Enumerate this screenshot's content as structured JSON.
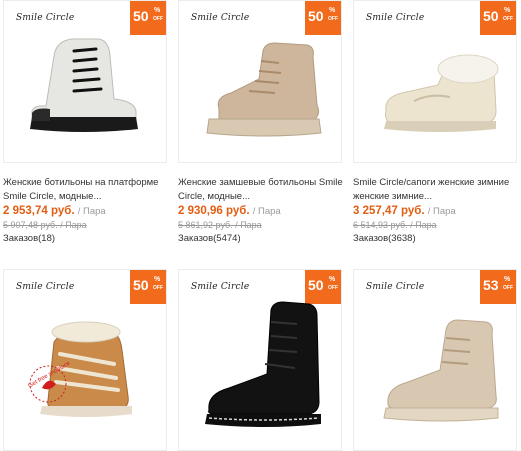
{
  "products": [
    {
      "brand": "Smile Circle",
      "discount": "50",
      "pct": "%",
      "off": "OFF",
      "title": "Женские ботильоны на платформе Smile Circle, модные...",
      "price": "2 953,74 руб.",
      "unit": "/ Пара",
      "old_price": "5 907,48 руб. / Пара",
      "orders": "Заказов(18)"
    },
    {
      "brand": "Smile Circle",
      "discount": "50",
      "pct": "%",
      "off": "OFF",
      "title": "Женские замшевые ботильоны Smile Circle, модные...",
      "price": "2 930,96 руб.",
      "unit": "/ Пара",
      "old_price": "5 861,92 руб. / Пара",
      "orders": "Заказов(5474)"
    },
    {
      "brand": "Smile Circle",
      "discount": "50",
      "pct": "%",
      "off": "OFF",
      "title": "Smile Circle/сапоги женские зимние женские зимние...",
      "price": "3 257,47 руб.",
      "unit": "/ Пара",
      "old_price": "6 514,93 руб. / Пара",
      "orders": "Заказов(3638)"
    },
    {
      "brand": "Smile Circle",
      "discount": "50",
      "pct": "%",
      "off": "OFF",
      "stamp": "Get free shoelace"
    },
    {
      "brand": "Smile Circle",
      "discount": "50",
      "pct": "%",
      "off": "OFF"
    },
    {
      "brand": "Smile Circle",
      "discount": "53",
      "pct": "%",
      "off": "OFF"
    }
  ],
  "colors": {
    "accent": "#f26a1b",
    "price": "#e35d12"
  }
}
